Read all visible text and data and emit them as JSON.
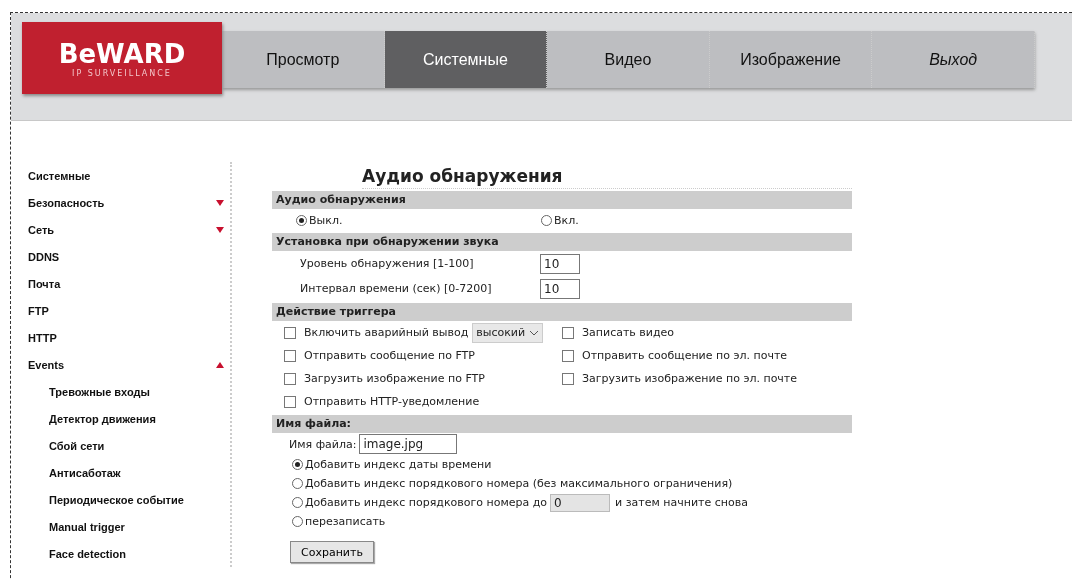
{
  "logo": {
    "brand": "BeWARD",
    "tagline": "IP SURVEILLANCE"
  },
  "tabs": [
    {
      "label": "Просмотр",
      "selected": false,
      "italic": false
    },
    {
      "label": "Системные",
      "selected": true,
      "italic": false
    },
    {
      "label": "Видео",
      "selected": false,
      "italic": false
    },
    {
      "label": "Изображение",
      "selected": false,
      "italic": false
    },
    {
      "label": "Выход",
      "selected": false,
      "italic": true
    }
  ],
  "sidebar": {
    "items": [
      {
        "label": "Системные"
      },
      {
        "label": "Безопасность",
        "expanded": false
      },
      {
        "label": "Сеть",
        "expanded": false
      },
      {
        "label": "DDNS"
      },
      {
        "label": "Почта"
      },
      {
        "label": "FTP"
      },
      {
        "label": "HTTP"
      },
      {
        "label": "Events",
        "expanded": true,
        "children": [
          {
            "label": "Тревожные входы"
          },
          {
            "label": "Детектор движения"
          },
          {
            "label": "Сбой сети"
          },
          {
            "label": "Антисаботаж"
          },
          {
            "label": "Периодическое событие"
          },
          {
            "label": "Manual trigger"
          },
          {
            "label": "Face detection"
          }
        ]
      }
    ]
  },
  "page_title": "Аудио обнаружения",
  "detection": {
    "header": "Аудио обнаружения",
    "options": [
      {
        "label": "Выкл.",
        "selected": true
      },
      {
        "label": "Вкл.",
        "selected": false
      }
    ]
  },
  "settings": {
    "header": "Установка при обнаружении звука",
    "fields": [
      {
        "label": "Уровень обнаружения [1-100]",
        "value": "10"
      },
      {
        "label": "Интервал времени (сек) [0-7200]",
        "value": "10"
      }
    ]
  },
  "trigger": {
    "header": "Действие триггера",
    "checkboxes": [
      {
        "label": "Включить аварийный вывод",
        "checked": false,
        "select": "высокий"
      },
      {
        "label": "Записать видео",
        "checked": false
      },
      {
        "label": "Отправить сообщение по FTP",
        "checked": false
      },
      {
        "label": "Отправить сообщение по эл. почте",
        "checked": false
      },
      {
        "label": "Загрузить изображение по FTP",
        "checked": false
      },
      {
        "label": "Загрузить изображение по эл. почте",
        "checked": false
      },
      {
        "label": "Отправить HTTP-уведомление",
        "checked": false
      }
    ]
  },
  "filename": {
    "header": "Имя файла:",
    "label": "Имя файла:",
    "value": "image.jpg",
    "options": [
      {
        "label": "Добавить индекс даты времени",
        "selected": true
      },
      {
        "label": "Добавить индекс порядкового номера (без максимального ограничения)",
        "selected": false
      },
      {
        "label": "Добавить индекс порядкового номера до",
        "selected": false,
        "field": {
          "value": "0",
          "disabled": true
        },
        "suffix": "и затем начните снова"
      },
      {
        "label": "перезаписать",
        "selected": false
      }
    ]
  },
  "save_button": "Сохранить"
}
